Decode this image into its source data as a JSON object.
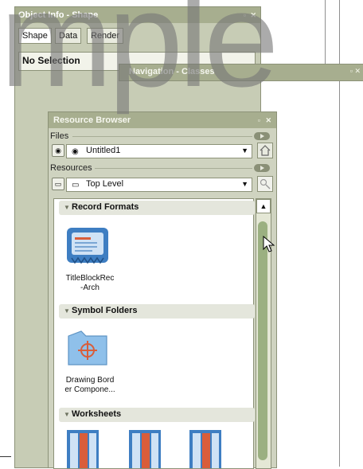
{
  "watermark": {
    "text": "mple"
  },
  "object_info": {
    "title": "Object Info - Shape",
    "tabs": [
      "Shape",
      "Data",
      "Render"
    ],
    "content": "No Selection"
  },
  "navigation": {
    "title": "Navigation - Classes"
  },
  "resource_browser": {
    "title": "Resource Browser",
    "files_label": "Files",
    "files_value": "Untitled1",
    "resources_label": "Resources",
    "resources_value": "Top Level",
    "sections": [
      {
        "title": "Record Formats",
        "items": [
          {
            "label": "TitleBlockRec-Arch",
            "line1": "TitleBlockRec",
            "line2": "-Arch",
            "icon": "record-format-icon"
          }
        ]
      },
      {
        "title": "Symbol Folders",
        "items": [
          {
            "label": "Drawing Border Compone...",
            "line1": "Drawing Bord",
            "line2": "er Compone...",
            "icon": "symbol-folder-icon"
          }
        ]
      },
      {
        "title": "Worksheets",
        "items": [
          {
            "icon": "worksheet-icon"
          },
          {
            "icon": "worksheet-icon"
          },
          {
            "icon": "worksheet-icon"
          }
        ]
      }
    ]
  },
  "colors": {
    "palette_title": "#a7ae8f",
    "palette_bg": "#c7ccb5",
    "scroll_thumb": "#9bb081",
    "worksheet_accent": "#d95d3a",
    "record_icon": "#3e7ec2"
  }
}
